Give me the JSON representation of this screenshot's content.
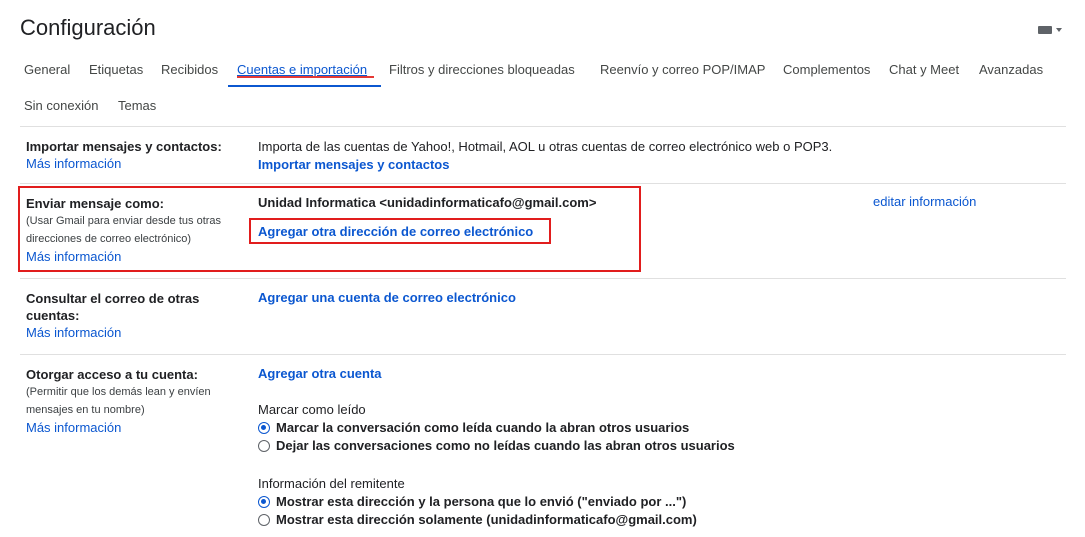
{
  "page": {
    "title": "Configuración"
  },
  "tabs": [
    {
      "label": "General",
      "active": false
    },
    {
      "label": "Etiquetas",
      "active": false
    },
    {
      "label": "Recibidos",
      "active": false
    },
    {
      "label": "Cuentas e importación",
      "active": true
    },
    {
      "label": "Filtros y direcciones bloqueadas",
      "active": false
    },
    {
      "label": "Reenvío y correo POP/IMAP",
      "active": false
    },
    {
      "label": "Complementos",
      "active": false
    },
    {
      "label": "Chat y Meet",
      "active": false
    },
    {
      "label": "Avanzadas",
      "active": false
    },
    {
      "label": "Sin conexión",
      "active": false
    },
    {
      "label": "Temas",
      "active": false
    }
  ],
  "sections": {
    "import": {
      "label": "Importar mensajes y contactos:",
      "more": "Más información",
      "description": "Importa de las cuentas de Yahoo!, Hotmail, AOL u otras cuentas de correo electrónico web o POP3.",
      "action": "Importar mensajes y contactos"
    },
    "send_as": {
      "label": "Enviar mensaje como:",
      "sub1": "(Usar Gmail para enviar desde tus otras",
      "sub2": "direcciones de correo electrónico)",
      "more": "Más información",
      "address": "Unidad Informatica <unidadinformaticafo@gmail.com>",
      "edit": "editar información",
      "action": "Agregar otra dirección de correo electrónico"
    },
    "check_mail": {
      "label1": "Consultar el correo de otras",
      "label2": "cuentas:",
      "more": "Más información",
      "action": "Agregar una cuenta de correo electrónico"
    },
    "grant_access": {
      "label": "Otorgar acceso a tu cuenta:",
      "sub1": "(Permitir que los demás lean y envíen",
      "sub2": "mensajes en tu nombre)",
      "more": "Más información",
      "action": "Agregar otra cuenta",
      "mark_read_heading": "Marcar como leído",
      "mark_read_options": [
        {
          "label": "Marcar la conversación como leída cuando la abran otros usuarios",
          "checked": true
        },
        {
          "label": "Dejar las conversaciones como no leídas cuando las abran otros usuarios",
          "checked": false
        }
      ],
      "sender_info_heading": "Información del remitente",
      "sender_info_options": [
        {
          "label": "Mostrar esta dirección y la persona que lo envió (\"enviado por ...\")",
          "checked": true
        },
        {
          "label": "Mostrar esta dirección solamente (unidadinformaticafo@gmail.com)",
          "checked": false
        }
      ]
    }
  },
  "colors": {
    "link": "#0b57d0",
    "highlight": "#e11d1d"
  }
}
